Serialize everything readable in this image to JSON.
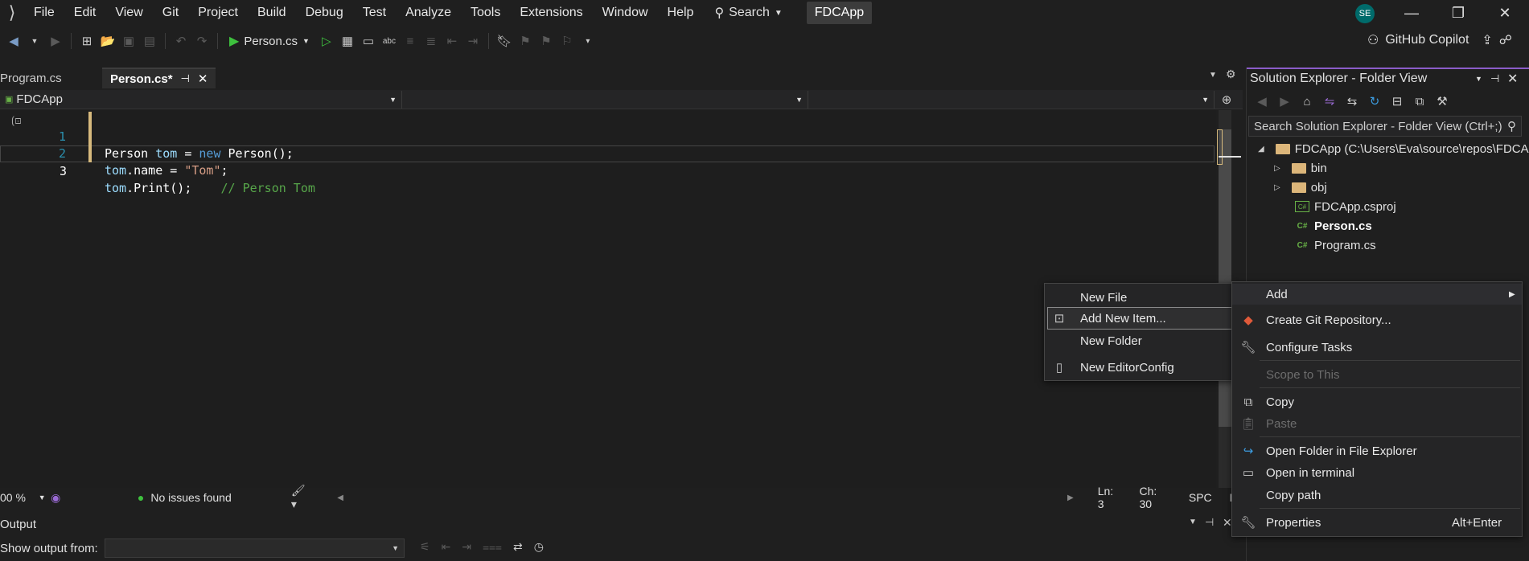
{
  "menubar": {
    "items": [
      "File",
      "Edit",
      "View",
      "Git",
      "Project",
      "Build",
      "Debug",
      "Test",
      "Analyze",
      "Tools",
      "Extensions",
      "Window",
      "Help"
    ],
    "search_label": "Search",
    "solution_name": "FDCApp",
    "avatar_initials": "SE"
  },
  "toolbar": {
    "run_target": "Person.cs",
    "copilot_label": "GitHub Copilot"
  },
  "tabs": [
    {
      "label": "Program.cs",
      "active": false
    },
    {
      "label": "Person.cs*",
      "active": true
    }
  ],
  "navbar": {
    "project": "FDCApp"
  },
  "editor": {
    "lines": [
      {
        "num": "1"
      },
      {
        "num": "2"
      },
      {
        "num": "3"
      }
    ],
    "code": {
      "l1": {
        "t1": "Person ",
        "t2": "tom",
        "t3": " = ",
        "t4": "new",
        "t5": " Person();"
      },
      "l2": {
        "t1": "tom",
        "t2": ".name = ",
        "t3": "\"Tom\"",
        "t4": ";"
      },
      "l3": {
        "t1": "tom",
        "t2": ".Print();",
        "t3": "    // Person Tom"
      }
    }
  },
  "editor_status": {
    "zoom": "00 %",
    "issues": "No issues found",
    "line": "Ln: 3",
    "col": "Ch: 30",
    "spacing": "SPC",
    "eol": "LF"
  },
  "output": {
    "title": "Output",
    "show_from_label": "Show output from:"
  },
  "solution_explorer": {
    "title": "Solution Explorer - Folder View",
    "search_placeholder": "Search Solution Explorer - Folder View (Ctrl+;)",
    "root": "FDCApp (C:\\Users\\Eva\\source\\repos\\FDCA",
    "items": [
      {
        "label": "bin",
        "type": "folder"
      },
      {
        "label": "obj",
        "type": "folder"
      },
      {
        "label": "FDCApp.csproj",
        "type": "csproj"
      },
      {
        "label": "Person.cs",
        "type": "cs"
      },
      {
        "label": "Program.cs",
        "type": "cs"
      }
    ]
  },
  "context_menu": {
    "add": "Add",
    "create_git": "Create Git Repository...",
    "configure_tasks": "Configure Tasks",
    "scope": "Scope to This",
    "copy": "Copy",
    "paste": "Paste",
    "open_folder": "Open Folder in File Explorer",
    "open_terminal": "Open in terminal",
    "copy_path": "Copy path",
    "properties": "Properties",
    "properties_shortcut": "Alt+Enter"
  },
  "submenu": {
    "new_file": "New File",
    "add_new_item": "Add New Item...",
    "new_folder": "New Folder",
    "new_editorconfig": "New EditorConfig"
  }
}
